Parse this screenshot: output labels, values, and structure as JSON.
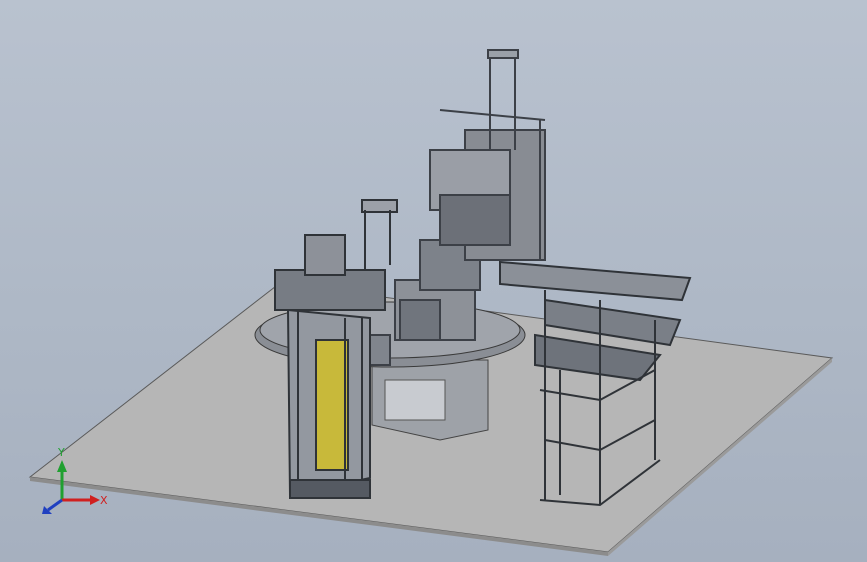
{
  "viewport": {
    "background_top": "#b9c2cf",
    "background_bottom": "#a6b0bf"
  },
  "scene": {
    "description_icon": "cad-assembly-icon",
    "floor_color": "#b5b5b5",
    "frame_color": "#3c4047",
    "frame_light": "#6a707a",
    "accent_yellow": "#c8b93a"
  },
  "triad": {
    "x_label": "X",
    "y_label": "Y",
    "x_color": "#d02020",
    "y_color": "#20a030",
    "z_color": "#2040c0"
  }
}
